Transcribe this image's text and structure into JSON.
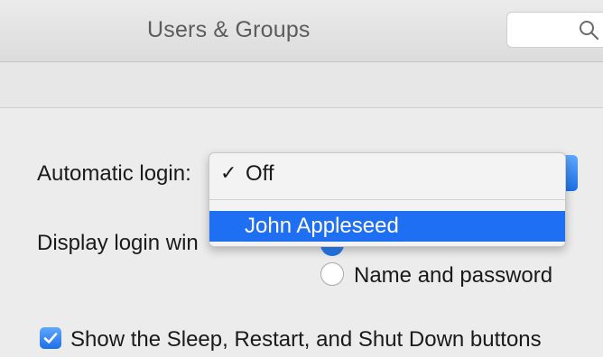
{
  "window": {
    "title": "Users & Groups"
  },
  "search": {
    "placeholder": "",
    "icon": "search-icon"
  },
  "login_options": {
    "automatic_login_label": "Automatic login:",
    "display_login_label": "Display login win",
    "automatic_login_menu": {
      "items": [
        {
          "label": "Off",
          "checked": true,
          "checkmark": "✓"
        },
        {
          "label": "John Appleseed",
          "highlighted": true
        }
      ]
    },
    "display_login_options": {
      "name_and_password_label": "Name and password"
    },
    "show_buttons_checkbox": {
      "label": "Show the Sleep, Restart, and Shut Down buttons",
      "checked": true
    }
  },
  "colors": {
    "accent": "#1f6ff2",
    "background": "#ececec"
  }
}
